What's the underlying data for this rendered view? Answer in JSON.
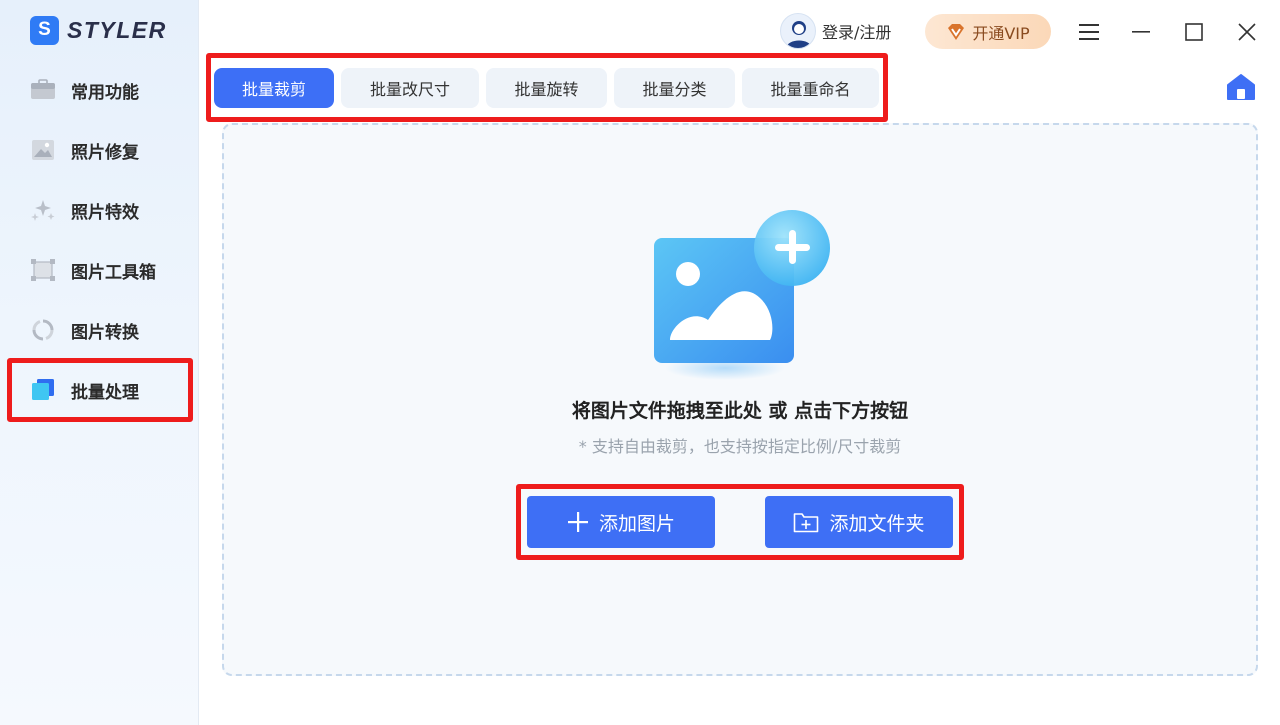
{
  "app": {
    "logo_letter": "S",
    "logo_text": "STYLER"
  },
  "sidebar": {
    "items": [
      {
        "label": "常用功能",
        "icon": "briefcase-icon"
      },
      {
        "label": "照片修复",
        "icon": "photo-repair-icon"
      },
      {
        "label": "照片特效",
        "icon": "sparkle-icon"
      },
      {
        "label": "图片工具箱",
        "icon": "toolbox-frame-icon"
      },
      {
        "label": "图片转换",
        "icon": "convert-icon"
      },
      {
        "label": "批量处理",
        "icon": "batch-layers-icon",
        "selected": true
      }
    ]
  },
  "header": {
    "login_label": "登录/注册",
    "vip_label": "开通VIP",
    "vip_icon": "diamond-v-icon",
    "window_controls": [
      "menu-icon",
      "minimize-icon",
      "maximize-icon",
      "close-icon"
    ]
  },
  "tabs": [
    {
      "label": "批量裁剪",
      "active": true
    },
    {
      "label": "批量改尺寸",
      "active": false
    },
    {
      "label": "批量旋转",
      "active": false
    },
    {
      "label": "批量分类",
      "active": false
    },
    {
      "label": "批量重命名",
      "active": false
    }
  ],
  "dropzone": {
    "title": "将图片文件拖拽至此处 或 点击下方按钮",
    "subtitle": "* 支持自由裁剪，也支持按指定比例/尺寸裁剪",
    "add_image_label": "添加图片",
    "add_folder_label": "添加文件夹"
  },
  "colors": {
    "accent": "#3e6ff5",
    "highlight": "#ee1c1c",
    "vip_bg": "#fbd8b8",
    "sidebar_bg": "#e6f0fb"
  }
}
